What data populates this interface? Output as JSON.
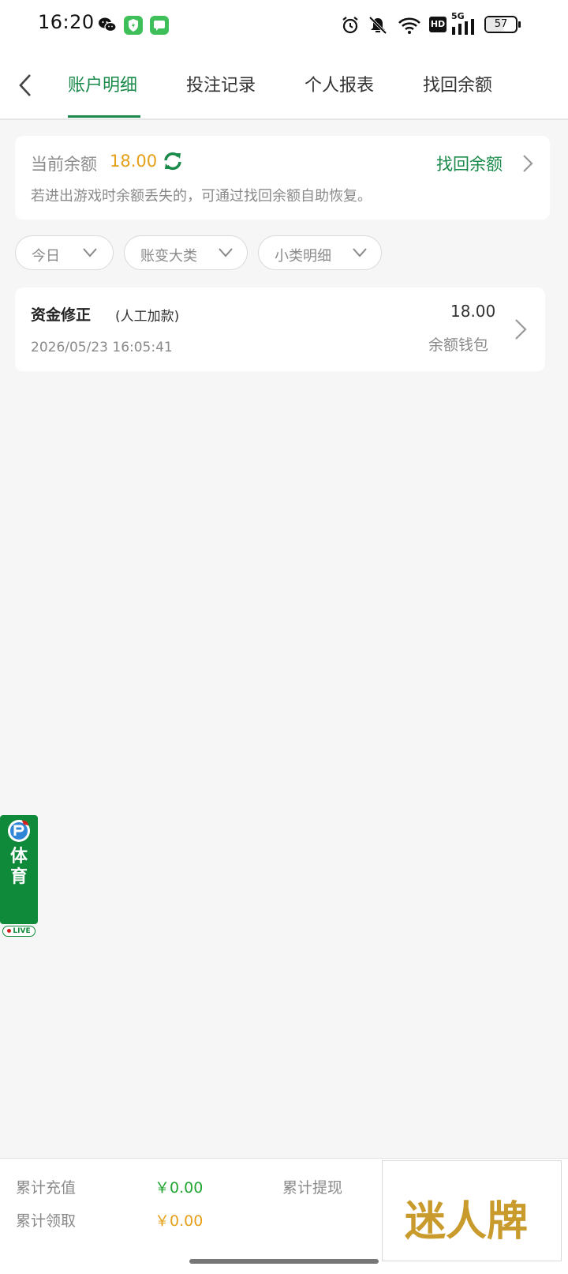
{
  "status_bar": {
    "time": "16:20",
    "battery": "57",
    "network": "5G",
    "hd": "HD",
    "icons": [
      "wechat-icon",
      "shield-app-icon",
      "message-app-icon",
      "alarm-icon",
      "mute-icon",
      "wifi-icon",
      "hd-icon",
      "signal-icon",
      "battery-icon"
    ]
  },
  "nav": {
    "tabs": [
      {
        "label": "账户明细",
        "active": true
      },
      {
        "label": "投注记录",
        "active": false
      },
      {
        "label": "个人报表",
        "active": false
      },
      {
        "label": "找回余额",
        "active": false
      }
    ],
    "accent": "#1a8a4a"
  },
  "balance": {
    "label": "当前余额",
    "value": "18.00",
    "recover_label": "找回余额",
    "note": "若进出游戏时余额丢失的，可通过找回余额自助恢复。",
    "value_color": "#e6a019"
  },
  "filters": [
    {
      "label": "今日"
    },
    {
      "label": "账变大类"
    },
    {
      "label": "小类明细"
    }
  ],
  "records": [
    {
      "title": "资金修正",
      "subtitle": "(人工加款)",
      "date": "2026/05/23 16:05:41",
      "amount": "18.00",
      "wallet": "余额钱包"
    }
  ],
  "sports_widget": {
    "text": "体育",
    "live": "LIVE"
  },
  "footer": {
    "recharge_label": "累计充值",
    "recharge_value": "￥0.00",
    "withdraw_label": "累计提现",
    "claim_label": "累计领取",
    "claim_value": "￥0.00",
    "banner_text": "迷人牌"
  }
}
